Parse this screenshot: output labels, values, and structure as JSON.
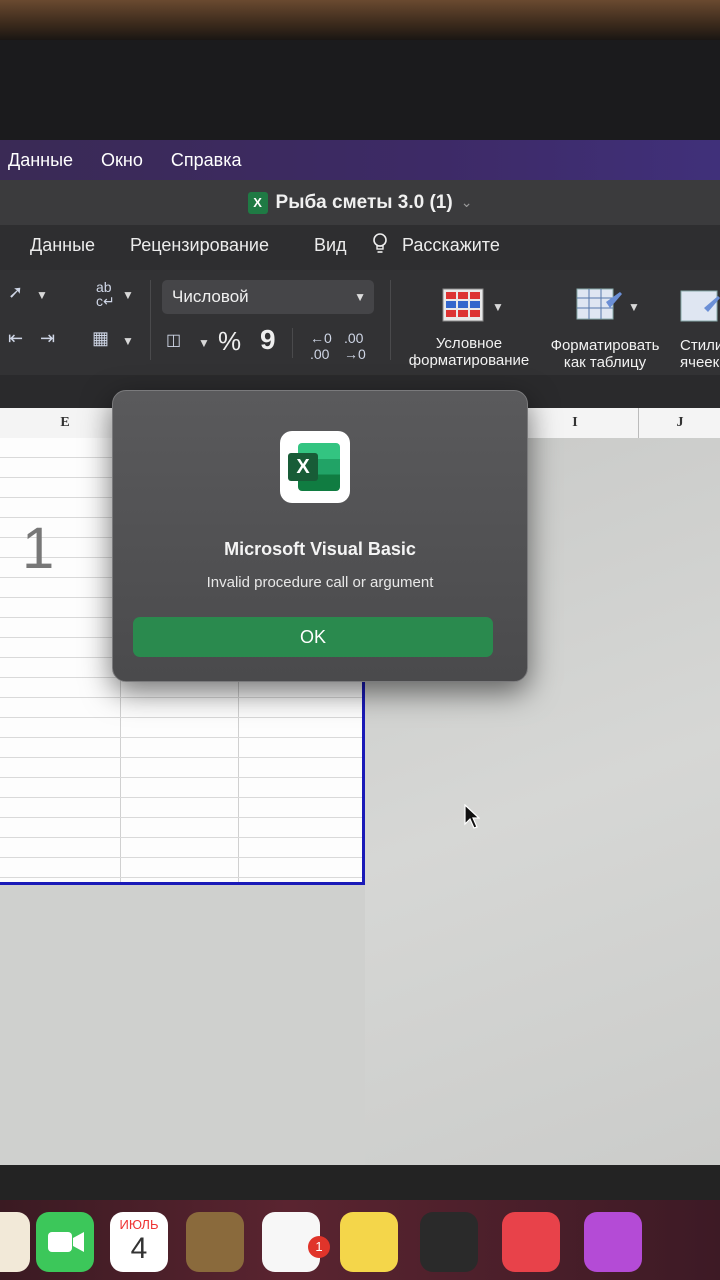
{
  "menubar": {
    "items": [
      "Данные",
      "Окно",
      "Справка"
    ]
  },
  "window": {
    "title": "Рыба сметы 3.0 (1)"
  },
  "ribbon_tabs": {
    "data": "Данные",
    "review": "Рецензирование",
    "view": "Вид",
    "tell_me": "Расскажите"
  },
  "ribbon": {
    "number_format": "Числовой",
    "percent": "%",
    "comma": "9",
    "conditional_formatting": "Условное форматирование",
    "format_as_table": "Форматировать как таблицу",
    "cell_styles": "Стили ячеек"
  },
  "sheet": {
    "columns": [
      "E",
      "I",
      "J"
    ],
    "cell_value": "1"
  },
  "dialog": {
    "title": "Microsoft Visual Basic",
    "message": "Invalid procedure call or argument",
    "ok_label": "OK",
    "icon_letter": "X"
  },
  "dock": {
    "calendar_month": "ИЮЛЬ",
    "calendar_day": "4",
    "reminders_badge": "1"
  },
  "colors": {
    "accent_green": "#2a8a4e",
    "menubar": "#3d2a66"
  }
}
